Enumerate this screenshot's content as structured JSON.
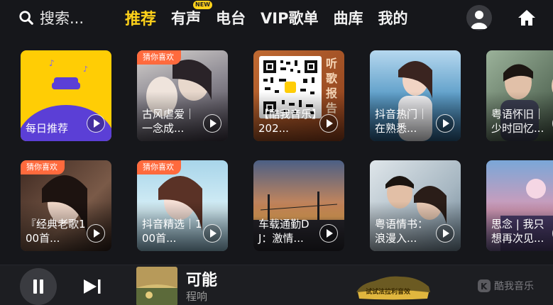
{
  "search": {
    "placeholder": "搜索..."
  },
  "tabs": [
    {
      "label": "推荐",
      "active": true
    },
    {
      "label": "有声",
      "badge": "NEW"
    },
    {
      "label": "电台"
    },
    {
      "label": "VIP歌单"
    },
    {
      "label": "曲库"
    },
    {
      "label": "我的"
    }
  ],
  "icons": {
    "search": "search-icon",
    "avatar": "user-avatar-icon",
    "home": "home-icon",
    "play": "play-icon",
    "pause": "pause-icon",
    "next": "skip-next-icon"
  },
  "row1": [
    {
      "title": "每日推荐",
      "tag": ""
    },
    {
      "title": "古风虐爱｜一念成...",
      "tag": "猜你喜欢"
    },
    {
      "title": "【酷我音乐】202...",
      "tag": "",
      "qr_side_text": "听歌报告"
    },
    {
      "title": "抖音热门｜在熟悉...",
      "tag": ""
    },
    {
      "title": "粤语怀旧｜少时回忆...",
      "tag": ""
    }
  ],
  "row2": [
    {
      "title": "『经典老歌100首...",
      "tag": "猜你喜欢"
    },
    {
      "title": "抖音精选｜100首...",
      "tag": "猜你喜欢"
    },
    {
      "title": "车载通勤DJ：激情...",
      "tag": ""
    },
    {
      "title": "粤语情书：浪漫入...",
      "tag": ""
    },
    {
      "title": "思念 | 我只想再次见...",
      "tag": ""
    }
  ],
  "player": {
    "song": "可能",
    "artist": "程响",
    "ferrari_promo": "试试法拉利音效",
    "brand": "酷我音乐"
  },
  "colors": {
    "accent": "#ffd21a",
    "tag": "#ff6a3d",
    "background": "#16171b"
  }
}
